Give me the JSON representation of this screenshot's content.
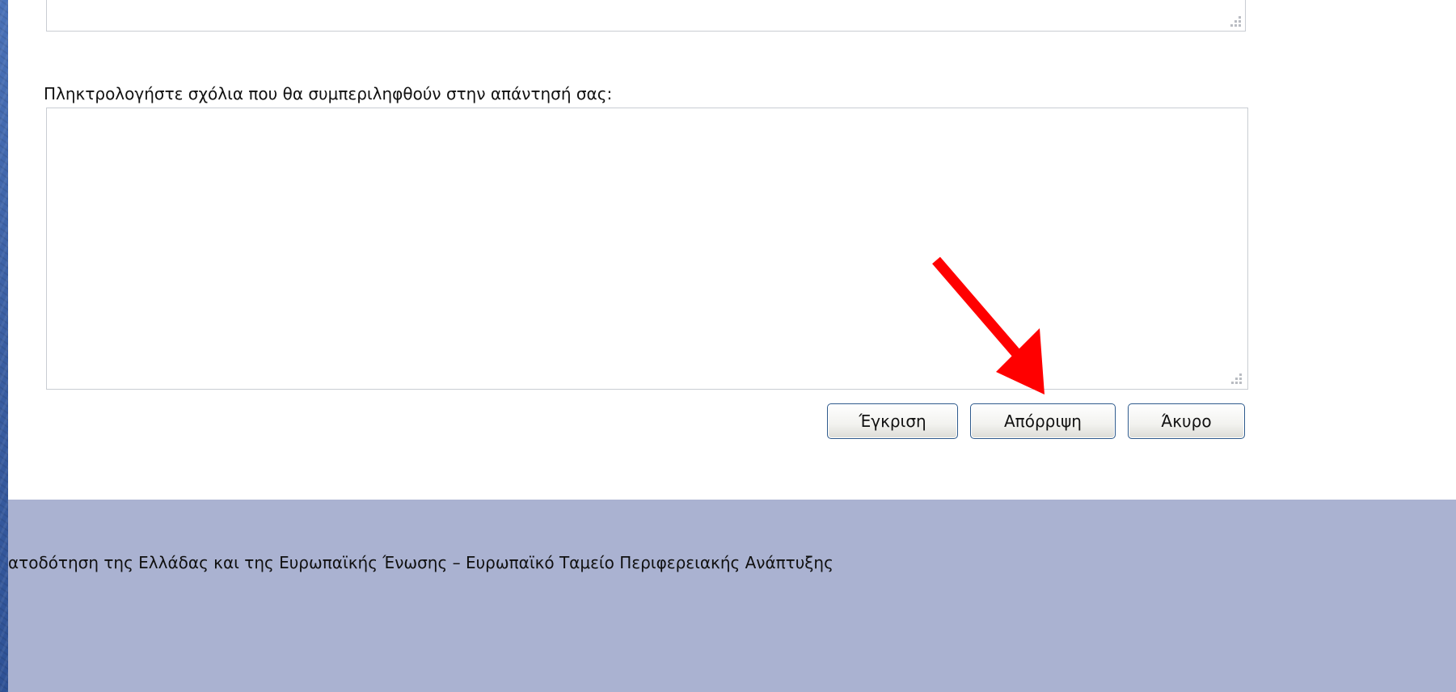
{
  "form": {
    "comments_label": "Πληκτρολογήστε σχόλια που θα συμπεριληφθούν στην απάντησή σας:",
    "comments_value": "",
    "buttons": {
      "approve": "Έγκριση",
      "reject": "Απόρριψη",
      "cancel": "Άκυρο"
    }
  },
  "footer": {
    "text": "ατοδότηση της Ελλάδας και της Ευρωπαϊκής Ένωσης – Ευρωπαϊκό Ταμείο Περιφερειακής Ανάπτυξης"
  },
  "annotation": {
    "arrow_color": "#ff0000",
    "arrow_icon": "red-arrow-icon"
  },
  "colors": {
    "footer_bg": "#aab2d1",
    "background_blue": "#3d63a8",
    "button_border": "#2e5a8c"
  }
}
